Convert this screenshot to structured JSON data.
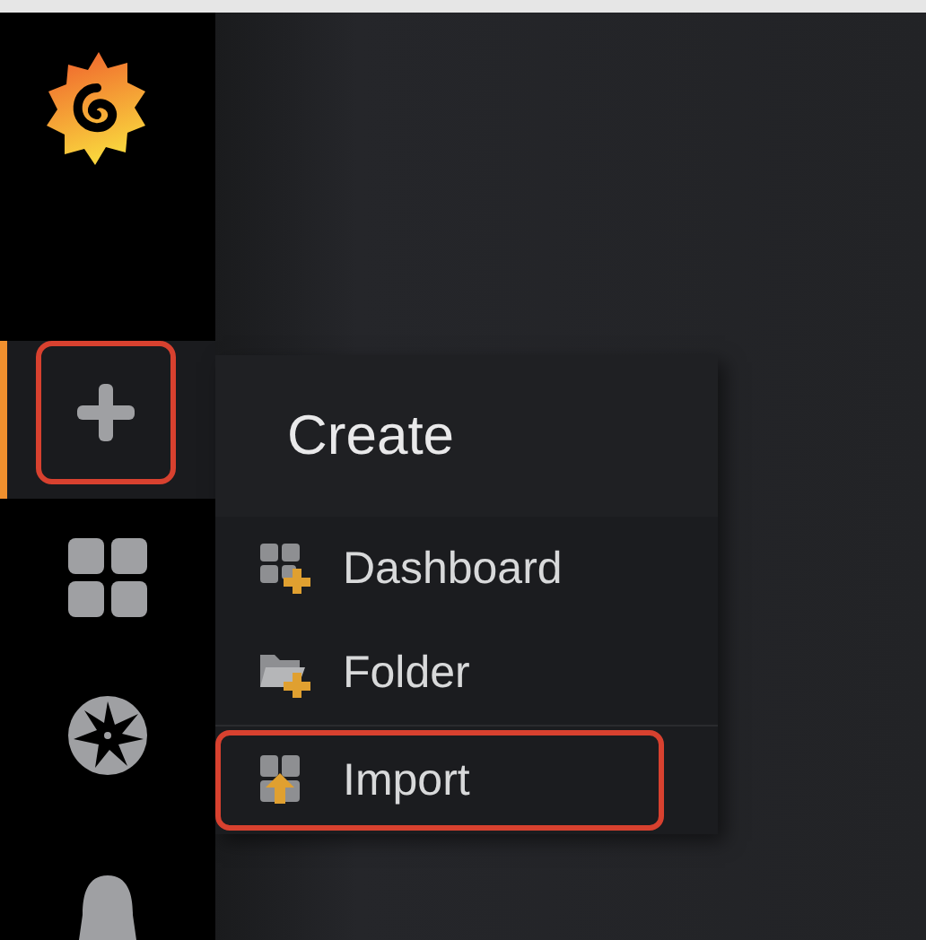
{
  "sidebar": {
    "items": [
      {
        "kind": "create",
        "selected": true,
        "annotated": true
      },
      {
        "kind": "dashboards",
        "selected": false,
        "annotated": false
      },
      {
        "kind": "explore",
        "selected": false,
        "annotated": false
      },
      {
        "kind": "alerting",
        "selected": false,
        "annotated": false
      }
    ]
  },
  "menu": {
    "title": "Create",
    "items": [
      {
        "kind": "dashboard",
        "label": "Dashboard",
        "annotated": false
      },
      {
        "kind": "folder",
        "label": "Folder",
        "annotated": false
      },
      {
        "kind": "import",
        "label": "Import",
        "annotated": true
      }
    ]
  }
}
